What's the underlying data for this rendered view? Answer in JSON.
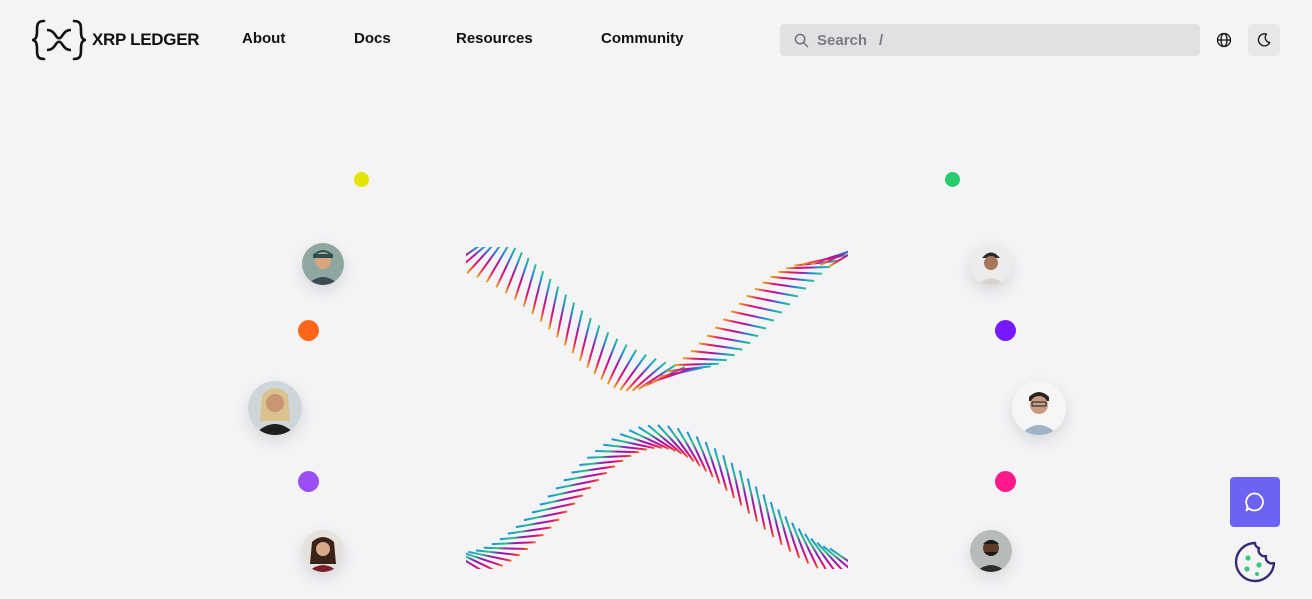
{
  "header": {
    "logo_text": "XRP LEDGER",
    "nav": [
      {
        "label": "About"
      },
      {
        "label": "Docs"
      },
      {
        "label": "Resources"
      },
      {
        "label": "Community"
      }
    ],
    "search": {
      "placeholder": "Search",
      "shortcut": "/"
    },
    "icons": {
      "language": "globe-icon",
      "theme": "moon-icon"
    }
  },
  "hero": {
    "dots_left": [
      "#e4e400",
      "#ff6619",
      "#9a4ff2"
    ],
    "dots_right": [
      "#28cc6e",
      "#7919ff",
      "#ff198b"
    ],
    "x_gradient_top": [
      "#e8b019",
      "#e8195f",
      "#b0119c",
      "#1e8be0",
      "#28c781"
    ],
    "x_gradient_bottom": [
      "#1e8be0",
      "#28c781",
      "#8a1fb3",
      "#b0119c",
      "#e8195f",
      "#e87a19"
    ]
  },
  "floating": {
    "chat_icon": "chat-bubble-icon",
    "cookie_icon": "cookie-icon",
    "chat_color": "#6c63f3",
    "cookie_color": "#3a2a73"
  }
}
